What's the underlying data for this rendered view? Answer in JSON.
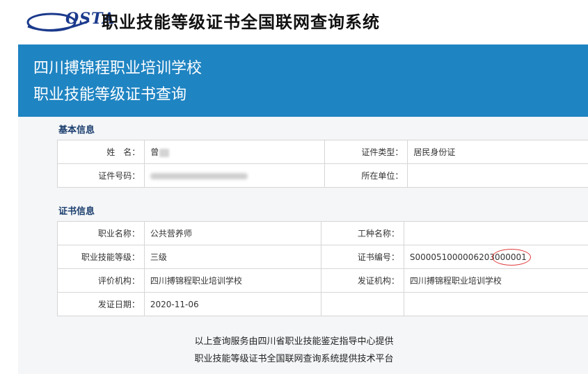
{
  "header": {
    "logo_text": "OSTA",
    "site_title": "职业技能等级证书全国联网查询系统"
  },
  "banner": {
    "line1": "四川搏锦程职业培训学校",
    "line2": "职业技能等级证书查询"
  },
  "basic_info": {
    "title": "基本信息",
    "name_label": "姓　名：",
    "name_value": "曾",
    "id_type_label": "证件类型：",
    "id_type_value": "居民身份证",
    "id_number_label": "证件号码：",
    "unit_label": "所在单位：",
    "unit_value": ""
  },
  "cert_info": {
    "title": "证书信息",
    "occupation_label": "职业名称：",
    "occupation_value": "公共营养师",
    "job_type_label": "工种名称：",
    "job_type_value": "",
    "level_label": "职业技能等级：",
    "level_value": "三级",
    "cert_no_label": "证书编号：",
    "cert_no_value": "S000051000006203000001",
    "eval_org_label": "评价机构：",
    "eval_org_value": "四川搏锦程职业培训学校",
    "issue_org_label": "发证机构：",
    "issue_org_value": "四川搏锦程职业培训学校",
    "issue_date_label": "发证日期：",
    "issue_date_value": "2020-11-06"
  },
  "footer": {
    "line1": "以上查询服务由四川省职业技能鉴定指导中心提供",
    "line2": "职业技能等级证书全国联网查询系统提供技术平台"
  },
  "colors": {
    "banner": "#1f84c2",
    "logo": "#1b3a8c",
    "highlight": "#e03b3b"
  }
}
